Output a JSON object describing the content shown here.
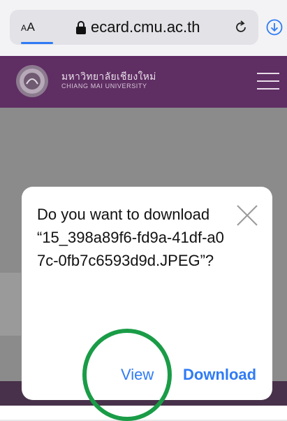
{
  "browser": {
    "text_size_label_small": "A",
    "text_size_label_large": "A",
    "url": "ecard.cmu.ac.th",
    "icons": [
      "lock-icon",
      "reload-icon",
      "download-icon"
    ],
    "accent_color": "#2f7bf5"
  },
  "site": {
    "university_thai": "มหาวิทยาลัยเชียงใหม่",
    "university_english": "CHIANG MAI UNIVERSITY",
    "header_color": "#5f2e63"
  },
  "dialog": {
    "message": "Do you want to download “15_398a89f6-fd9a-41df-a07c-0fb7c6593d9d.JPEG”?",
    "view_label": "View",
    "download_label": "Download"
  },
  "annotation": {
    "color": "#1a9c47"
  }
}
